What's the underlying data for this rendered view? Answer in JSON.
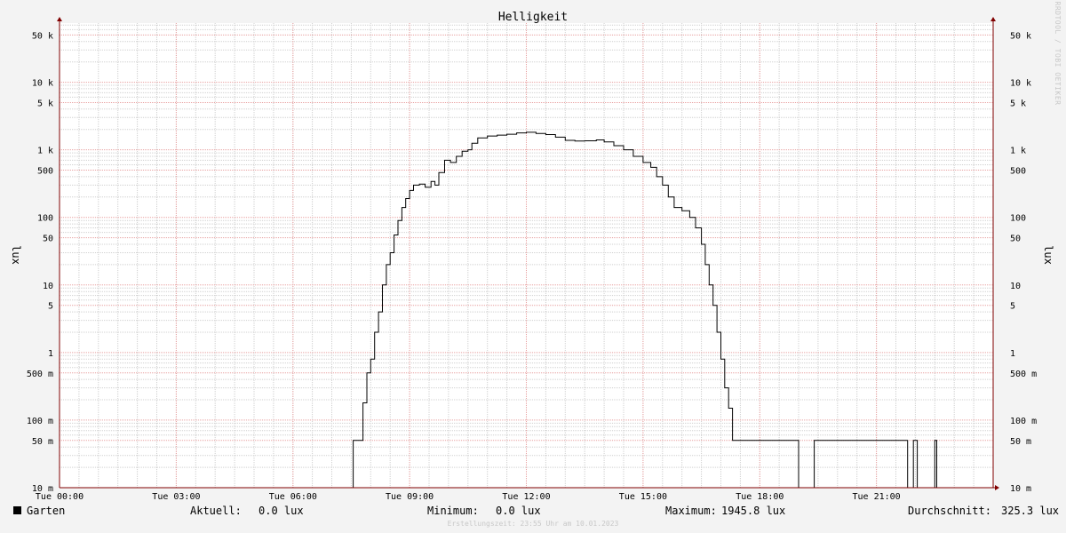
{
  "watermark": "RRDTOOL / TOBI OETIKER",
  "legend": {
    "series_label": "Garten",
    "series_color": "#000000",
    "current_label": "Aktuell:",
    "current_value": "0.0 lux",
    "min_label": "Minimum:",
    "min_value": "0.0 lux",
    "max_label": "Maximum:",
    "max_value": "1945.8 lux",
    "avg_label": "Durchschnitt:",
    "avg_value": "325.3 lux"
  },
  "footer": "Erstellungszeit: 23:55 Uhr am 10.01.2023",
  "colors": {
    "background": "#f3f3f3",
    "plot_background": "#ffffff",
    "major_grid": "#e8a0a0",
    "minor_grid": "#d0d0d0",
    "axis": "#800000",
    "line": "#000000"
  },
  "chart_data": {
    "type": "line",
    "title": "Helligkeit",
    "ylabel": "lux",
    "ylabel_right": "lux",
    "yscale": "log",
    "ylim": [
      0.01,
      75000
    ],
    "xlim": [
      0,
      24
    ],
    "grid": true,
    "x_ticks": [
      {
        "value": 0,
        "label": "Tue 00:00"
      },
      {
        "value": 3,
        "label": "Tue 03:00"
      },
      {
        "value": 6,
        "label": "Tue 06:00"
      },
      {
        "value": 9,
        "label": "Tue 09:00"
      },
      {
        "value": 12,
        "label": "Tue 12:00"
      },
      {
        "value": 15,
        "label": "Tue 15:00"
      },
      {
        "value": 18,
        "label": "Tue 18:00"
      },
      {
        "value": 21,
        "label": "Tue 21:00"
      }
    ],
    "y_ticks": [
      {
        "value": 0.01,
        "label": "10 m"
      },
      {
        "value": 0.05,
        "label": "50 m"
      },
      {
        "value": 0.1,
        "label": "100 m"
      },
      {
        "value": 0.5,
        "label": "500 m"
      },
      {
        "value": 1,
        "label": "1"
      },
      {
        "value": 5,
        "label": "5"
      },
      {
        "value": 10,
        "label": "10"
      },
      {
        "value": 50,
        "label": "50"
      },
      {
        "value": 100,
        "label": "100"
      },
      {
        "value": 500,
        "label": "500"
      },
      {
        "value": 1000,
        "label": "1 k"
      },
      {
        "value": 5000,
        "label": "5 k"
      },
      {
        "value": 10000,
        "label": "10 k"
      },
      {
        "value": 50000,
        "label": "50 k"
      }
    ],
    "series": [
      {
        "name": "Garten",
        "color": "#000000",
        "step": true,
        "points": [
          [
            0,
            0.01
          ],
          [
            7.55,
            0.05
          ],
          [
            7.8,
            0.18
          ],
          [
            7.9,
            0.5
          ],
          [
            8.0,
            0.8
          ],
          [
            8.1,
            2
          ],
          [
            8.2,
            4
          ],
          [
            8.3,
            10
          ],
          [
            8.4,
            20
          ],
          [
            8.5,
            30
          ],
          [
            8.6,
            55
          ],
          [
            8.7,
            90
          ],
          [
            8.8,
            140
          ],
          [
            8.9,
            190
          ],
          [
            9.0,
            250
          ],
          [
            9.1,
            300
          ],
          [
            9.25,
            310
          ],
          [
            9.4,
            280
          ],
          [
            9.55,
            340
          ],
          [
            9.65,
            300
          ],
          [
            9.75,
            460
          ],
          [
            9.9,
            700
          ],
          [
            10.05,
            650
          ],
          [
            10.2,
            800
          ],
          [
            10.35,
            950
          ],
          [
            10.5,
            1000
          ],
          [
            10.6,
            1250
          ],
          [
            10.75,
            1500
          ],
          [
            11.0,
            1600
          ],
          [
            11.25,
            1650
          ],
          [
            11.5,
            1700
          ],
          [
            11.75,
            1780
          ],
          [
            12.0,
            1820
          ],
          [
            12.25,
            1750
          ],
          [
            12.5,
            1680
          ],
          [
            12.75,
            1540
          ],
          [
            13.0,
            1380
          ],
          [
            13.25,
            1350
          ],
          [
            13.5,
            1360
          ],
          [
            13.8,
            1400
          ],
          [
            14.0,
            1310
          ],
          [
            14.25,
            1150
          ],
          [
            14.5,
            1000
          ],
          [
            14.75,
            800
          ],
          [
            15.0,
            650
          ],
          [
            15.2,
            550
          ],
          [
            15.35,
            400
          ],
          [
            15.5,
            300
          ],
          [
            15.65,
            200
          ],
          [
            15.8,
            140
          ],
          [
            16.0,
            125
          ],
          [
            16.2,
            100
          ],
          [
            16.35,
            70
          ],
          [
            16.5,
            40
          ],
          [
            16.6,
            20
          ],
          [
            16.7,
            10
          ],
          [
            16.8,
            5
          ],
          [
            16.9,
            2
          ],
          [
            17.0,
            0.8
          ],
          [
            17.1,
            0.3
          ],
          [
            17.2,
            0.15
          ],
          [
            17.3,
            0.05
          ],
          [
            19.0,
            0.01
          ],
          [
            19.4,
            0.05
          ],
          [
            21.8,
            0.01
          ],
          [
            21.95,
            0.05
          ],
          [
            22.05,
            0.01
          ],
          [
            22.5,
            0.05
          ],
          [
            22.55,
            0.01
          ],
          [
            24,
            0.01
          ]
        ]
      }
    ]
  }
}
